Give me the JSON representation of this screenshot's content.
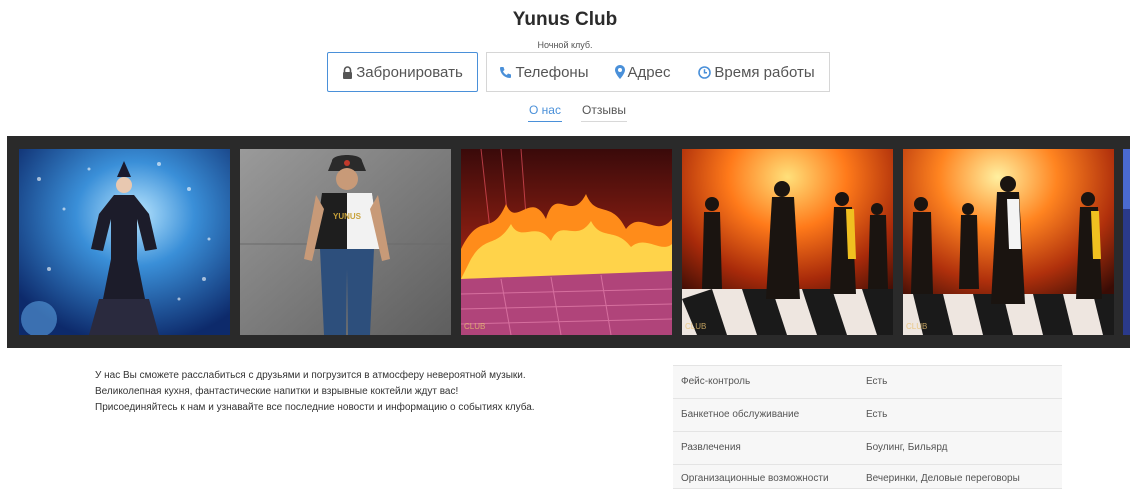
{
  "header": {
    "title": "Yunus Club",
    "subtitle": "Ночной клуб."
  },
  "actions": {
    "book": "Забронировать",
    "phones": "Телефоны",
    "address": "Адрес",
    "hours": "Время работы"
  },
  "tabs": {
    "about": "О нас",
    "reviews": "Отзывы"
  },
  "gallery": {
    "photos": [
      {
        "label": ""
      },
      {
        "label": "YUNUS"
      },
      {
        "label": "CLUB"
      },
      {
        "label": "CLUB"
      },
      {
        "label": "CLUB"
      }
    ]
  },
  "description": {
    "lines": [
      "У нас Вы сможете расслабиться с друзьями и погрузится в атмосферу невероятной музыки.",
      "Великолепная кухня, фантастические напитки и взрывные коктейли ждут вас!",
      "Присоединяйтесь к нам и узнавайте все последние новости и информацию о событиях клуба."
    ]
  },
  "info_table": {
    "rows": [
      {
        "key": "Фейс-контроль",
        "value": "Есть"
      },
      {
        "key": "Банкетное обслуживание",
        "value": "Есть"
      },
      {
        "key": "Развлечения",
        "value": "Боулинг, Бильярд"
      },
      {
        "key": "Организационные возможности",
        "value": "Вечеринки, Деловые переговоры"
      }
    ]
  },
  "colors": {
    "accent": "#4a90d9",
    "gallery_bg": "#2a2a2a"
  }
}
